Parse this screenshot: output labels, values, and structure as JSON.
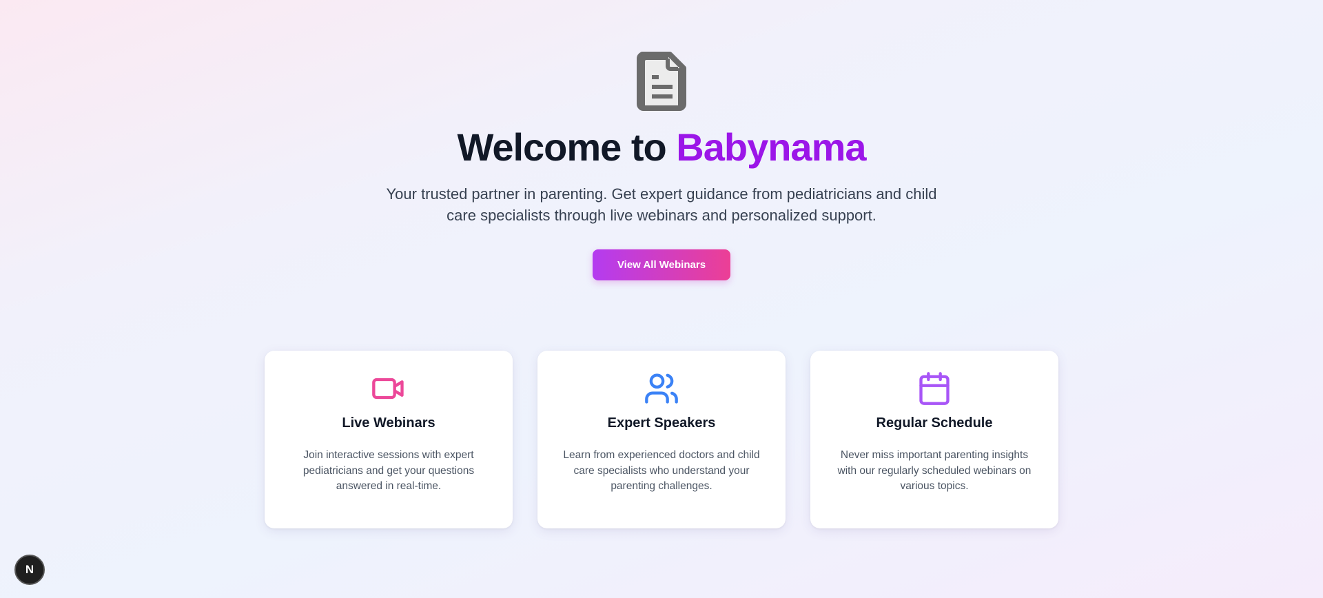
{
  "hero": {
    "icon": "document-icon",
    "title_prefix": "Welcome to ",
    "title_brand": "Babynama",
    "subtitle": "Your trusted partner in parenting. Get expert guidance from pediatricians and child care specialists through live webinars and personalized support.",
    "cta_label": "View All Webinars"
  },
  "features": [
    {
      "icon": "video-camera-icon",
      "icon_color": "#ec4899",
      "title": "Live Webinars",
      "description": "Join interactive sessions with expert pediatricians and get your questions answered in real-time."
    },
    {
      "icon": "users-icon",
      "icon_color": "#3b82f6",
      "title": "Expert Speakers",
      "description": "Learn from experienced doctors and child care specialists who understand your parenting challenges."
    },
    {
      "icon": "calendar-icon",
      "icon_color": "#a855f7",
      "title": "Regular Schedule",
      "description": "Never miss important parenting insights with our regularly scheduled webinars on various topics."
    }
  ],
  "dev_badge": {
    "label": "N"
  },
  "colors": {
    "brand": "#9b16e8",
    "cta_start": "#b43cf0",
    "cta_end": "#ec3f95"
  }
}
